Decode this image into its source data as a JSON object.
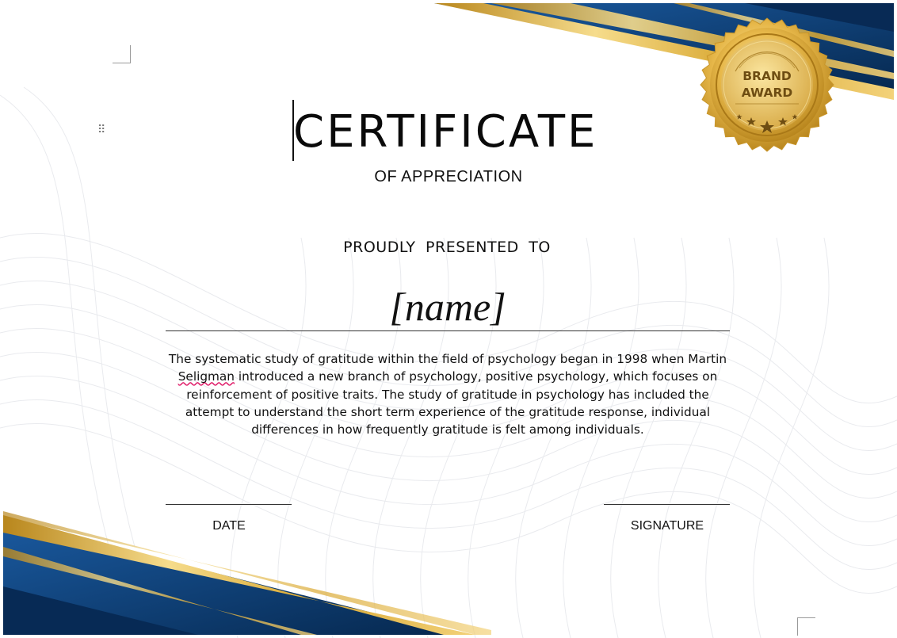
{
  "certificate": {
    "title": "CERTIFICATE",
    "subtitle": "OF APPRECIATION",
    "presented_to": "PROUDLY PRESENTED TO",
    "name_placeholder": "[name]",
    "body_before": "The systematic study of gratitude within the field of psychology began in 1998 when Martin ",
    "body_flagged_word": "Seligman",
    "body_after": " introduced a new branch of psychology, positive psychology, which focuses on reinforcement of positive traits.  The study of gratitude in psychology has included the attempt to understand the short term experience of the gratitude response, individual differences in how frequently gratitude is felt among individuals.",
    "date_label": "DATE",
    "signature_label": "SIGNATURE"
  },
  "badge": {
    "line1": "BRAND",
    "line2": "AWARD"
  },
  "colors": {
    "navy": "#0b3a6e",
    "gold": "#d4a22a",
    "gold_light": "#f3d27a",
    "spelling_underline": "#e0206b"
  },
  "icons": {
    "drag_handle": "drag-handle-icon",
    "badge_stars": "star-icon"
  }
}
